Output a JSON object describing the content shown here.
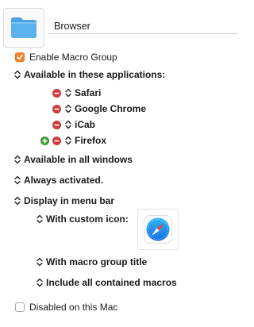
{
  "group": {
    "name": "Browser"
  },
  "enable_macro_group": {
    "label": "Enable Macro Group",
    "checked": true
  },
  "available_apps": {
    "label": "Available in these applications:",
    "apps": [
      {
        "name": "Safari"
      },
      {
        "name": "Google Chrome"
      },
      {
        "name": "iCab"
      },
      {
        "name": "Firefox"
      }
    ]
  },
  "available_windows": {
    "label": "Available in all windows"
  },
  "activation": {
    "label": "Always activated."
  },
  "menu_bar": {
    "label": "Display in menu bar",
    "custom_icon": {
      "label": "With custom icon:"
    },
    "macro_group_title": {
      "label": "With macro group title"
    },
    "contained_macros": {
      "label": "Include all contained macros"
    }
  },
  "disabled_on_mac": {
    "label": "Disabled on this Mac",
    "checked": false
  },
  "colors": {
    "accent_orange": "#f0832c",
    "minus_red": "#d03b3b",
    "plus_green": "#3a9a3a",
    "folder_blue": "#5ab2ee"
  }
}
